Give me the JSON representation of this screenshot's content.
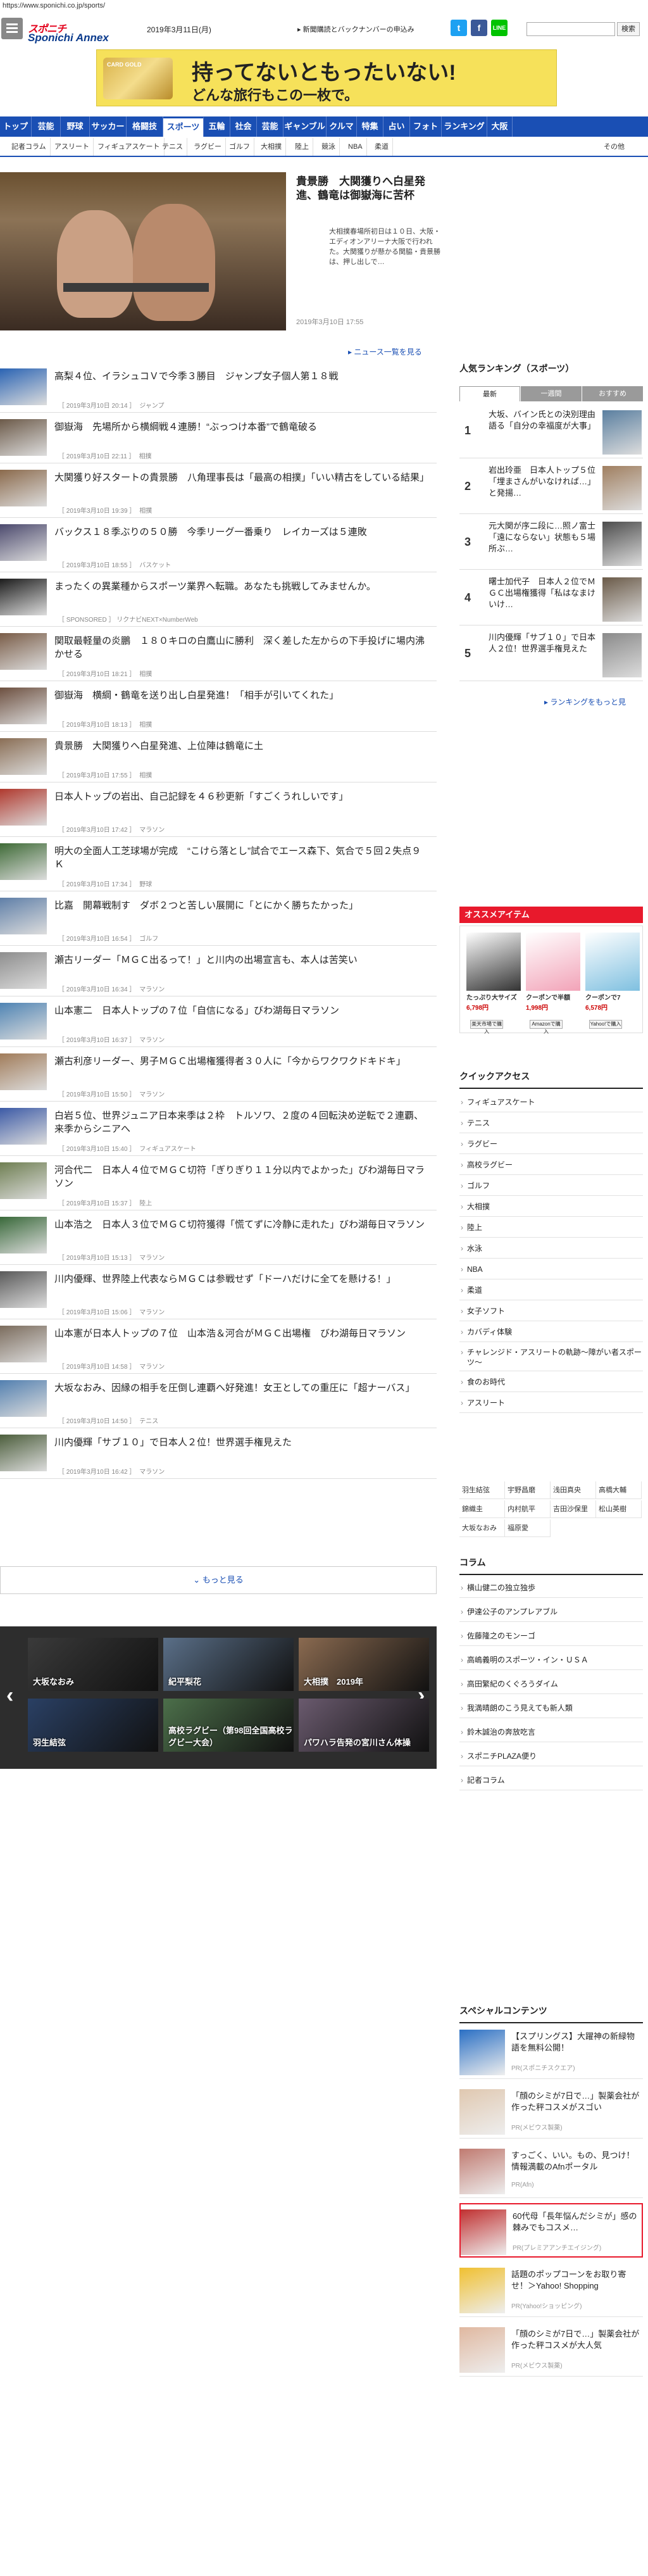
{
  "url": "https://www.sponichi.co.jp/sports/",
  "header": {
    "logo_top": "スポニチ",
    "logo_bottom": "Sponichi Annex",
    "date": "2019年3月11日(月)",
    "subscribe_link": "新聞購読とバックナンバーの申込み",
    "sns": [
      "twitter-icon",
      "facebook-icon",
      "line-icon"
    ],
    "search_placeholder": "",
    "search_button": "検索"
  },
  "ad": {
    "card_label": "CARD GOLD",
    "line1": "持ってないともったいない!",
    "line2": "どんな旅行もこの一枚で。"
  },
  "nav": {
    "items": [
      "トップ",
      "芸能",
      "野球",
      "サッカー",
      "格闘技",
      "スポーツ",
      "五輪",
      "社会",
      "芸能",
      "ギャンブル",
      "クルマ",
      "特集",
      "占い",
      "フォト",
      "ランキング",
      "大阪"
    ],
    "active": "スポーツ"
  },
  "subnav": {
    "items": [
      "記者コラム",
      "アスリート",
      "フィギュアスケート",
      "テニス",
      "ラグビー",
      "ゴルフ",
      "大相撲",
      "陸上",
      "競泳",
      "NBA",
      "柔道"
    ],
    "more": "その他"
  },
  "feature": {
    "title": "貴景勝　大関獲りへ白星発進、鶴竜は御嶽海に苦杯",
    "body": "大相撲春場所初日は１０日、大阪・エディオンアリーナ大阪で行われた。大関獲りが懸かる関脇・貴景勝は、押し出しで…",
    "date": "2019年3月10日 17:55",
    "news_more": "ニュース一覧を見る"
  },
  "news": [
    {
      "title": "高梨４位、イラシュコＶで今季３勝目　ジャンプ女子個人第１８戦",
      "date": "［ 2019年3月10日 20:14 ］",
      "cat": "ジャンプ"
    },
    {
      "title": "御嶽海　先場所から横綱戦４連勝！“ぶっつけ本番”で鶴竜破る",
      "date": "［ 2019年3月10日 22:11 ］",
      "cat": "相撲"
    },
    {
      "title": "大関獲り好スタートの貴景勝　八角理事長は「最高の相撲」「いい精古をしている結果」",
      "date": "［ 2019年3月10日 19:39 ］",
      "cat": "相撲"
    },
    {
      "title": "バックス１８季ぶりの５０勝　今季リーグ一番乗り　レイカーズは５連敗",
      "date": "［ 2019年3月10日 18:55 ］",
      "cat": "バスケット"
    },
    {
      "title": "まったくの異業種からスポーツ業界へ転職。あなたも挑戦してみませんか。",
      "date": "［ SPONSORED ］ リクナビNEXT×NumberWeb",
      "cat": ""
    },
    {
      "title": "関取最軽量の炎鵬　１８０キロの白鷹山に勝利　深く差した左からの下手投げに場内沸かせる",
      "date": "［ 2019年3月10日 18:21 ］",
      "cat": "相撲"
    },
    {
      "title": "御嶽海　横綱・鶴竜を送り出し白星発進！「相手が引いてくれた」",
      "date": "［ 2019年3月10日 18:13 ］",
      "cat": "相撲"
    },
    {
      "title": "貴景勝　大関獲りへ白星発進、上位陣は鶴竜に土",
      "date": "［ 2019年3月10日 17:55 ］",
      "cat": "相撲"
    },
    {
      "title": "日本人トップの岩出、自己記録を４６秒更新「すごくうれしいです」",
      "date": "［ 2019年3月10日 17:42 ］",
      "cat": "マラソン"
    },
    {
      "title": "明大の全面人工芝球場が完成　“こけら落とし”試合でエース森下、気合で５回２失点９Ｋ",
      "date": "［ 2019年3月10日 17:34 ］",
      "cat": "野球"
    },
    {
      "title": "比嘉　開幕戦制す　ダボ２つと苦しい展開に「とにかく勝ちたかった」",
      "date": "［ 2019年3月10日 16:54 ］",
      "cat": "ゴルフ"
    },
    {
      "title": "瀬古リーダー「ＭＧＣ出るって！」と川内の出場宣言も、本人は苦笑い",
      "date": "［ 2019年3月10日 16:34 ］",
      "cat": "マラソン"
    },
    {
      "title": "山本憲二　日本人トップの７位「自信になる」びわ湖毎日マラソン",
      "date": "［ 2019年3月10日 16:37 ］",
      "cat": "マラソン"
    },
    {
      "title": "瀬古利彦リーダー、男子ＭＧＣ出場権獲得者３０人に「今からワクワクドキドキ」",
      "date": "［ 2019年3月10日 15:50 ］",
      "cat": "マラソン"
    },
    {
      "title": "白岩５位、世界ジュニア日本来季は２枠　トルソワ、２度の４回転決め逆転で２連覇、来季からシニアへ",
      "date": "［ 2019年3月10日 15:40 ］",
      "cat": "フィギュアスケート"
    },
    {
      "title": "河合代二　日本人４位でＭＧＣ切符「ぎりぎり１１分以内でよかった」びわ湖毎日マラソン",
      "date": "［ 2019年3月10日 15:37 ］",
      "cat": "陸上"
    },
    {
      "title": "山本浩之　日本人３位でＭＧＣ切符獲得「慌てずに冷静に走れた」びわ湖毎日マラソン",
      "date": "［ 2019年3月10日 15:13 ］",
      "cat": "マラソン"
    },
    {
      "title": "川内優輝、世界陸上代表ならＭＧＣは参戦せず「ドーハだけに全てを懸ける！」",
      "date": "［ 2019年3月10日 15:06 ］",
      "cat": "マラソン"
    },
    {
      "title": "山本憲が日本人トップの７位　山本浩＆河合がＭＧＣ出場権　びわ湖毎日マラソン",
      "date": "［ 2019年3月10日 14:58 ］",
      "cat": "マラソン"
    },
    {
      "title": "大坂なおみ、因縁の相手を圧倒し連覇へ好発進！女王としての重圧に「超ナーバス」",
      "date": "［ 2019年3月10日 14:50 ］",
      "cat": "テニス"
    },
    {
      "title": "川内優輝「サブ１０」で日本人２位！世界選手権見えた",
      "date": "［ 2019年3月10日 16:42 ］",
      "cat": "マラソン"
    }
  ],
  "more_button": "もっと見る",
  "gallery": [
    "大坂なおみ",
    "紀平梨花",
    "大相撲　2019年",
    "羽生結弦",
    "高校ラグビー（第98回全国高校ラグビー大会）",
    "パワハラ告発の宮川さん体操"
  ],
  "ranking": {
    "title": "人気ランキング（スポーツ）",
    "tabs": [
      "最新",
      "一週間",
      "おすすめ"
    ],
    "items": [
      {
        "no": "1",
        "text": "大坂、バイン氏との決別理由語る「自分の幸福度が大事」"
      },
      {
        "no": "2",
        "text": "岩出玲亜　日本人トップ５位「埋まさんがいなければ…」と発揚…"
      },
      {
        "no": "3",
        "text": "元大関が序二段に…照ノ富士「遠にならない」状態も５場所ぶ…"
      },
      {
        "no": "4",
        "text": "曙士加代子　日本人２位でＭＧＣ出場権獲得「私はなまけいけ…"
      },
      {
        "no": "5",
        "text": "川内優輝「サブ１０」で日本人２位！世界選手権見えた"
      }
    ],
    "more": "ランキングをもっと見"
  },
  "osusume": {
    "title": "オススメアイテム",
    "prices": [
      "6,798円",
      "1,998円",
      "6,578円"
    ],
    "labels": [
      "たっぷり大サイズ",
      "クーポンで半額",
      "クーポンで7"
    ],
    "buttons": [
      "楽天市場で購入",
      "Amazonで購入",
      "Yahoo!で購入"
    ]
  },
  "quick_access": {
    "title": "クイックアクセス",
    "items": [
      "フィギュアスケート",
      "テニス",
      "ラグビー",
      "高校ラグビー",
      "ゴルフ",
      "大相撲",
      "陸上",
      "水泳",
      "NBA",
      "柔道",
      "女子ソフト",
      "カバディ体験",
      "チャレンジド・アスリートの軌跡～障がい者スポーツ～",
      "食のお時代",
      "アスリート"
    ],
    "grid": [
      "羽生結弦",
      "宇野昌磨",
      "浅田真央",
      "高橋大輔",
      "錦織圭",
      "内村航平",
      "吉田沙保里",
      "松山英樹",
      "大坂なおみ",
      "福原愛"
    ]
  },
  "column": {
    "title": "コラム",
    "items": [
      "横山健二の独立独歩",
      "伊達公子のアンプレアブル",
      "佐藤隆之のモンーゴ",
      "高嶋義明のスポーツ・イン・ＵＳＡ",
      "高田繁紀のくぐろうダイム",
      "我満晴朗のこう見えても新人類",
      "鈴木誠治の奔放吃言",
      "スポニチPLAZA便り",
      "記者コラム"
    ]
  },
  "special": {
    "title": "スペシャルコンテンツ",
    "items": [
      {
        "text": "【スプリングス】大躍神の新緑物語を無料公開！",
        "src": "PR(スポニチスクエア)"
      },
      {
        "text": "「顔のシミが7日で…」製薬会社が作った秤コスメがスゴい",
        "src": "PR(メビウス製薬)"
      },
      {
        "text": "すっごく、いい。もの、見つけ！情報満載のAfnポータル",
        "src": "PR(Afn)"
      },
      {
        "text": "60代母「長年悩んだシミが」感の棘みでもコスメ…",
        "src": "PR(プレミアアンチエイジング)"
      },
      {
        "text": "話題のポップコーンをお取り寄せ！＞Yahoo! Shopping",
        "src": "PR(Yahoo!ショッピング)"
      },
      {
        "text": "「顔のシミが7日で…」製薬会社が作った秤コスメが大人気",
        "src": "PR(メビウス製薬)"
      }
    ]
  }
}
